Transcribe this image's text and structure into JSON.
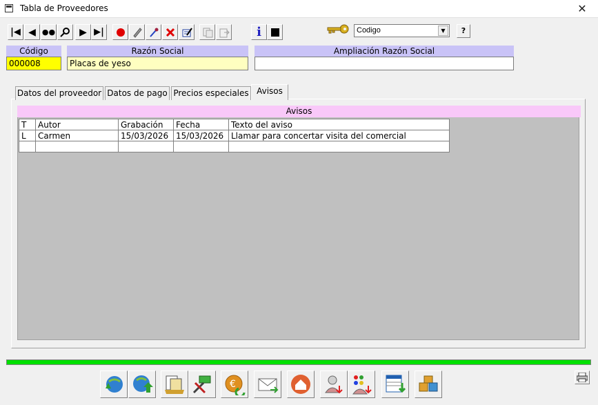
{
  "window": {
    "title": "Tabla de Proveedores",
    "close_glyph": "✕"
  },
  "toolbar": {
    "buttons": [
      {
        "icon": "first-record-icon",
        "glyph": "⏮"
      },
      {
        "icon": "previous-record-icon",
        "glyph": "◀"
      },
      {
        "icon": "binoculars-icon",
        "glyph": "🔭"
      },
      {
        "icon": "magnifier-icon",
        "glyph": "🔍"
      },
      {
        "icon": "next-record-icon",
        "glyph": "▶"
      },
      {
        "icon": "last-record-icon",
        "glyph": "⏭"
      },
      {
        "icon": "record-dot-icon",
        "glyph": "●"
      },
      {
        "icon": "eraser-icon",
        "glyph": "✎"
      },
      {
        "icon": "dropper-icon",
        "glyph": "✒"
      },
      {
        "icon": "delete-icon",
        "glyph": "✕"
      },
      {
        "icon": "edit-note-icon",
        "glyph": "✍"
      },
      {
        "icon": "copy-icon",
        "glyph": "⎘"
      },
      {
        "icon": "paste-icon",
        "glyph": "⎗"
      },
      {
        "icon": "info-icon",
        "glyph": "i"
      },
      {
        "icon": "stop-icon",
        "glyph": "■"
      }
    ],
    "search_field": {
      "selected": "Codigo",
      "help_label": "?"
    }
  },
  "fields": {
    "codigo": {
      "label": "Código",
      "value": "000008"
    },
    "razon_social": {
      "label": "Razón Social",
      "value": "Placas de yeso"
    },
    "ampliacion": {
      "label": "Ampliación Razón Social",
      "value": ""
    }
  },
  "tabs": [
    {
      "label": "Datos del proveedor"
    },
    {
      "label": "Datos de pago"
    },
    {
      "label": "Precios especiales"
    },
    {
      "label": "Avisos"
    }
  ],
  "avisos": {
    "title": "Avisos",
    "columns": [
      "T",
      "Autor",
      "Grabación",
      "Fecha",
      "Texto del aviso"
    ],
    "rows": [
      [
        "L",
        "Carmen",
        "15/03/2026",
        "15/03/2026",
        "Llamar para concertar visita del comercial"
      ],
      [
        "",
        "",
        "",
        "",
        ""
      ]
    ]
  },
  "colors": {
    "accent_label": "#c9c3f7",
    "avisos_header": "#f9c8f9",
    "progress": "#00e000",
    "codigo_bg": "#ffff00",
    "razon_bg": "#ffffc0"
  },
  "progress": {
    "percent": 100
  },
  "bottom_buttons": [
    "globe-sync-icon",
    "globe-upload-icon",
    "folder-documents-icon",
    "tools-money-icon",
    "euro-coin-icon",
    "email-icon",
    "home-upload-icon",
    "user-transfer-icon",
    "user-colors-icon",
    "spreadsheet-download-icon",
    "boxes-icon"
  ],
  "printer_icon": "printer-icon"
}
